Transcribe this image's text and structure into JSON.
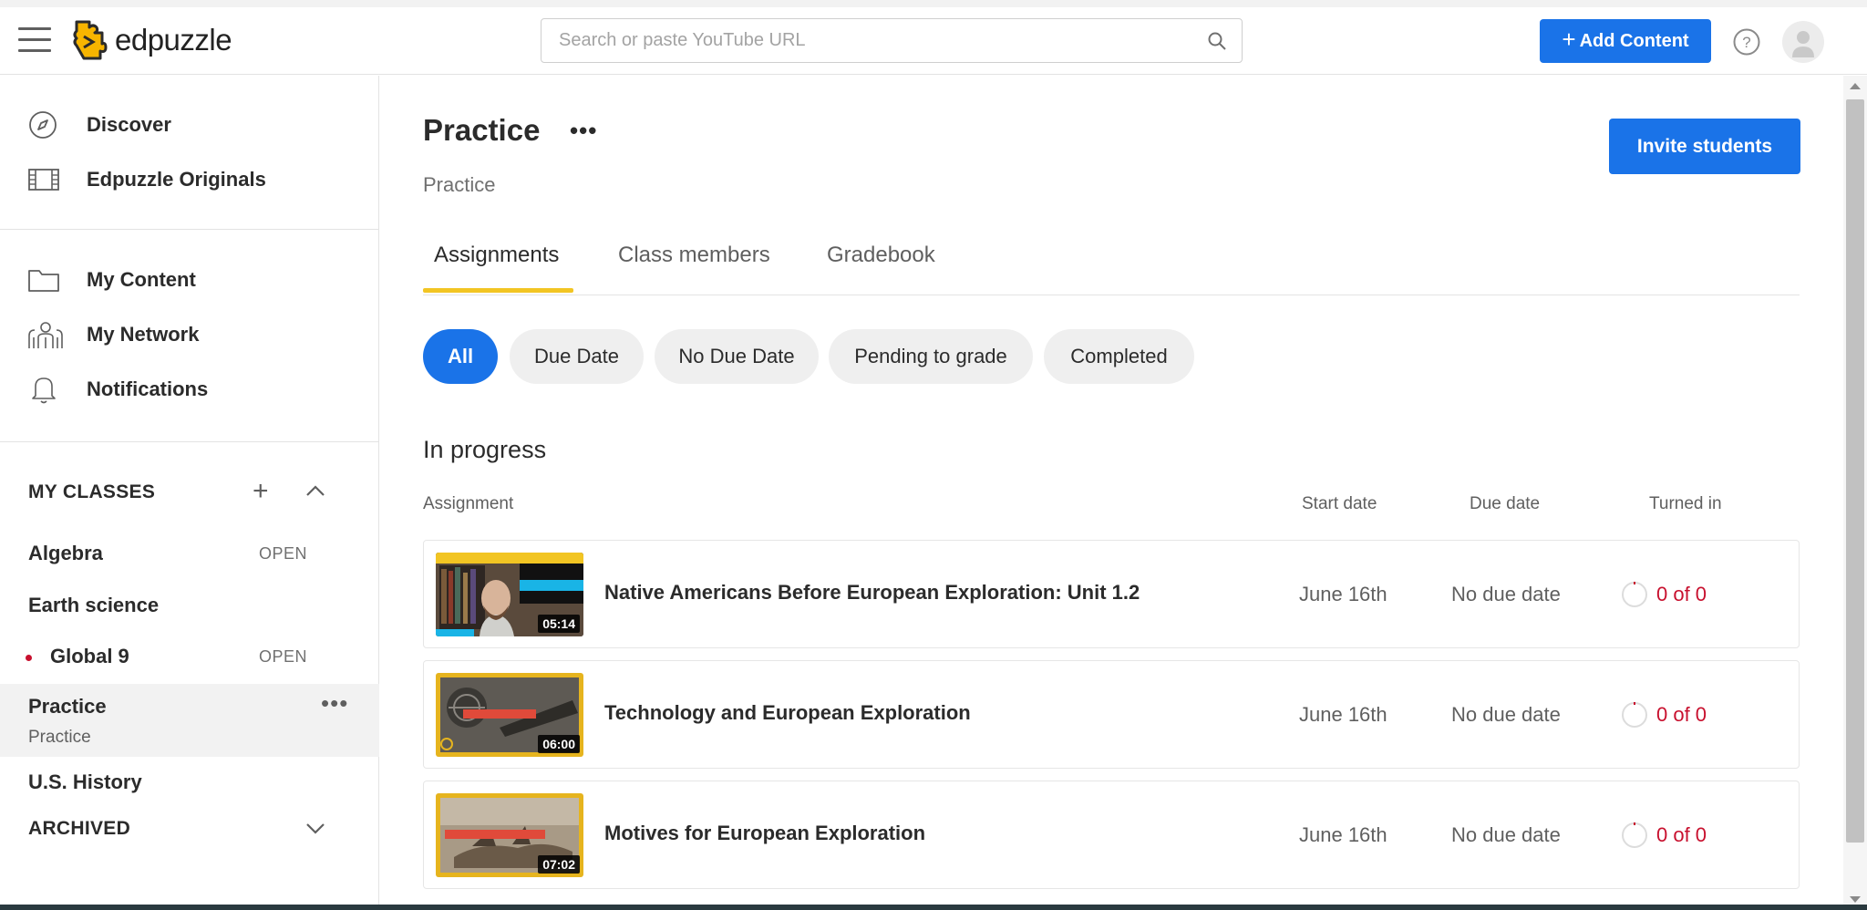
{
  "header": {
    "app_name": "edpuzzle",
    "search_placeholder": "Search or paste YouTube URL",
    "add_content_label": "Add Content"
  },
  "sidebar": {
    "top_items": [
      {
        "label": "Discover",
        "icon": "compass-icon"
      },
      {
        "label": "Edpuzzle Originals",
        "icon": "film-icon"
      }
    ],
    "mid_items": [
      {
        "label": "My Content",
        "icon": "folder-icon"
      },
      {
        "label": "My Network",
        "icon": "network-icon"
      },
      {
        "label": "Notifications",
        "icon": "bell-icon"
      }
    ],
    "my_classes_label": "MY CLASSES",
    "classes": [
      {
        "name": "Algebra",
        "status": "OPEN"
      },
      {
        "name": "Earth science",
        "status": ""
      },
      {
        "name": "Global 9",
        "status": "OPEN"
      },
      {
        "name": "Practice",
        "subtitle": "Practice"
      },
      {
        "name": "U.S. History",
        "status": ""
      }
    ],
    "archived_label": "ARCHIVED"
  },
  "main": {
    "title": "Practice",
    "subtitle": "Practice",
    "invite_label": "Invite students",
    "tabs": [
      {
        "label": "Assignments"
      },
      {
        "label": "Class members"
      },
      {
        "label": "Gradebook"
      }
    ],
    "filters": [
      {
        "label": "All"
      },
      {
        "label": "Due Date"
      },
      {
        "label": "No Due Date"
      },
      {
        "label": "Pending to grade"
      },
      {
        "label": "Completed"
      }
    ],
    "section_title": "In progress",
    "columns": {
      "assignment": "Assignment",
      "start": "Start date",
      "due": "Due date",
      "turned_in": "Turned in"
    },
    "assignments": [
      {
        "title": "Native Americans Before European Exploration: Unit 1.2",
        "start": "June 16th",
        "due": "No due date",
        "turned_in": "0 of 0",
        "duration": "05:14"
      },
      {
        "title": "Technology and European Exploration",
        "start": "June 16th",
        "due": "No due date",
        "turned_in": "0 of 0",
        "duration": "06:00"
      },
      {
        "title": "Motives for European Exploration",
        "start": "June 16th",
        "due": "No due date",
        "turned_in": "0 of 0",
        "duration": "07:02"
      }
    ]
  },
  "colors": {
    "accent_blue": "#1a73e8",
    "tab_underline": "#f2c523",
    "turned_in_red": "#c8102e",
    "logo_yellow": "#f7b500"
  }
}
